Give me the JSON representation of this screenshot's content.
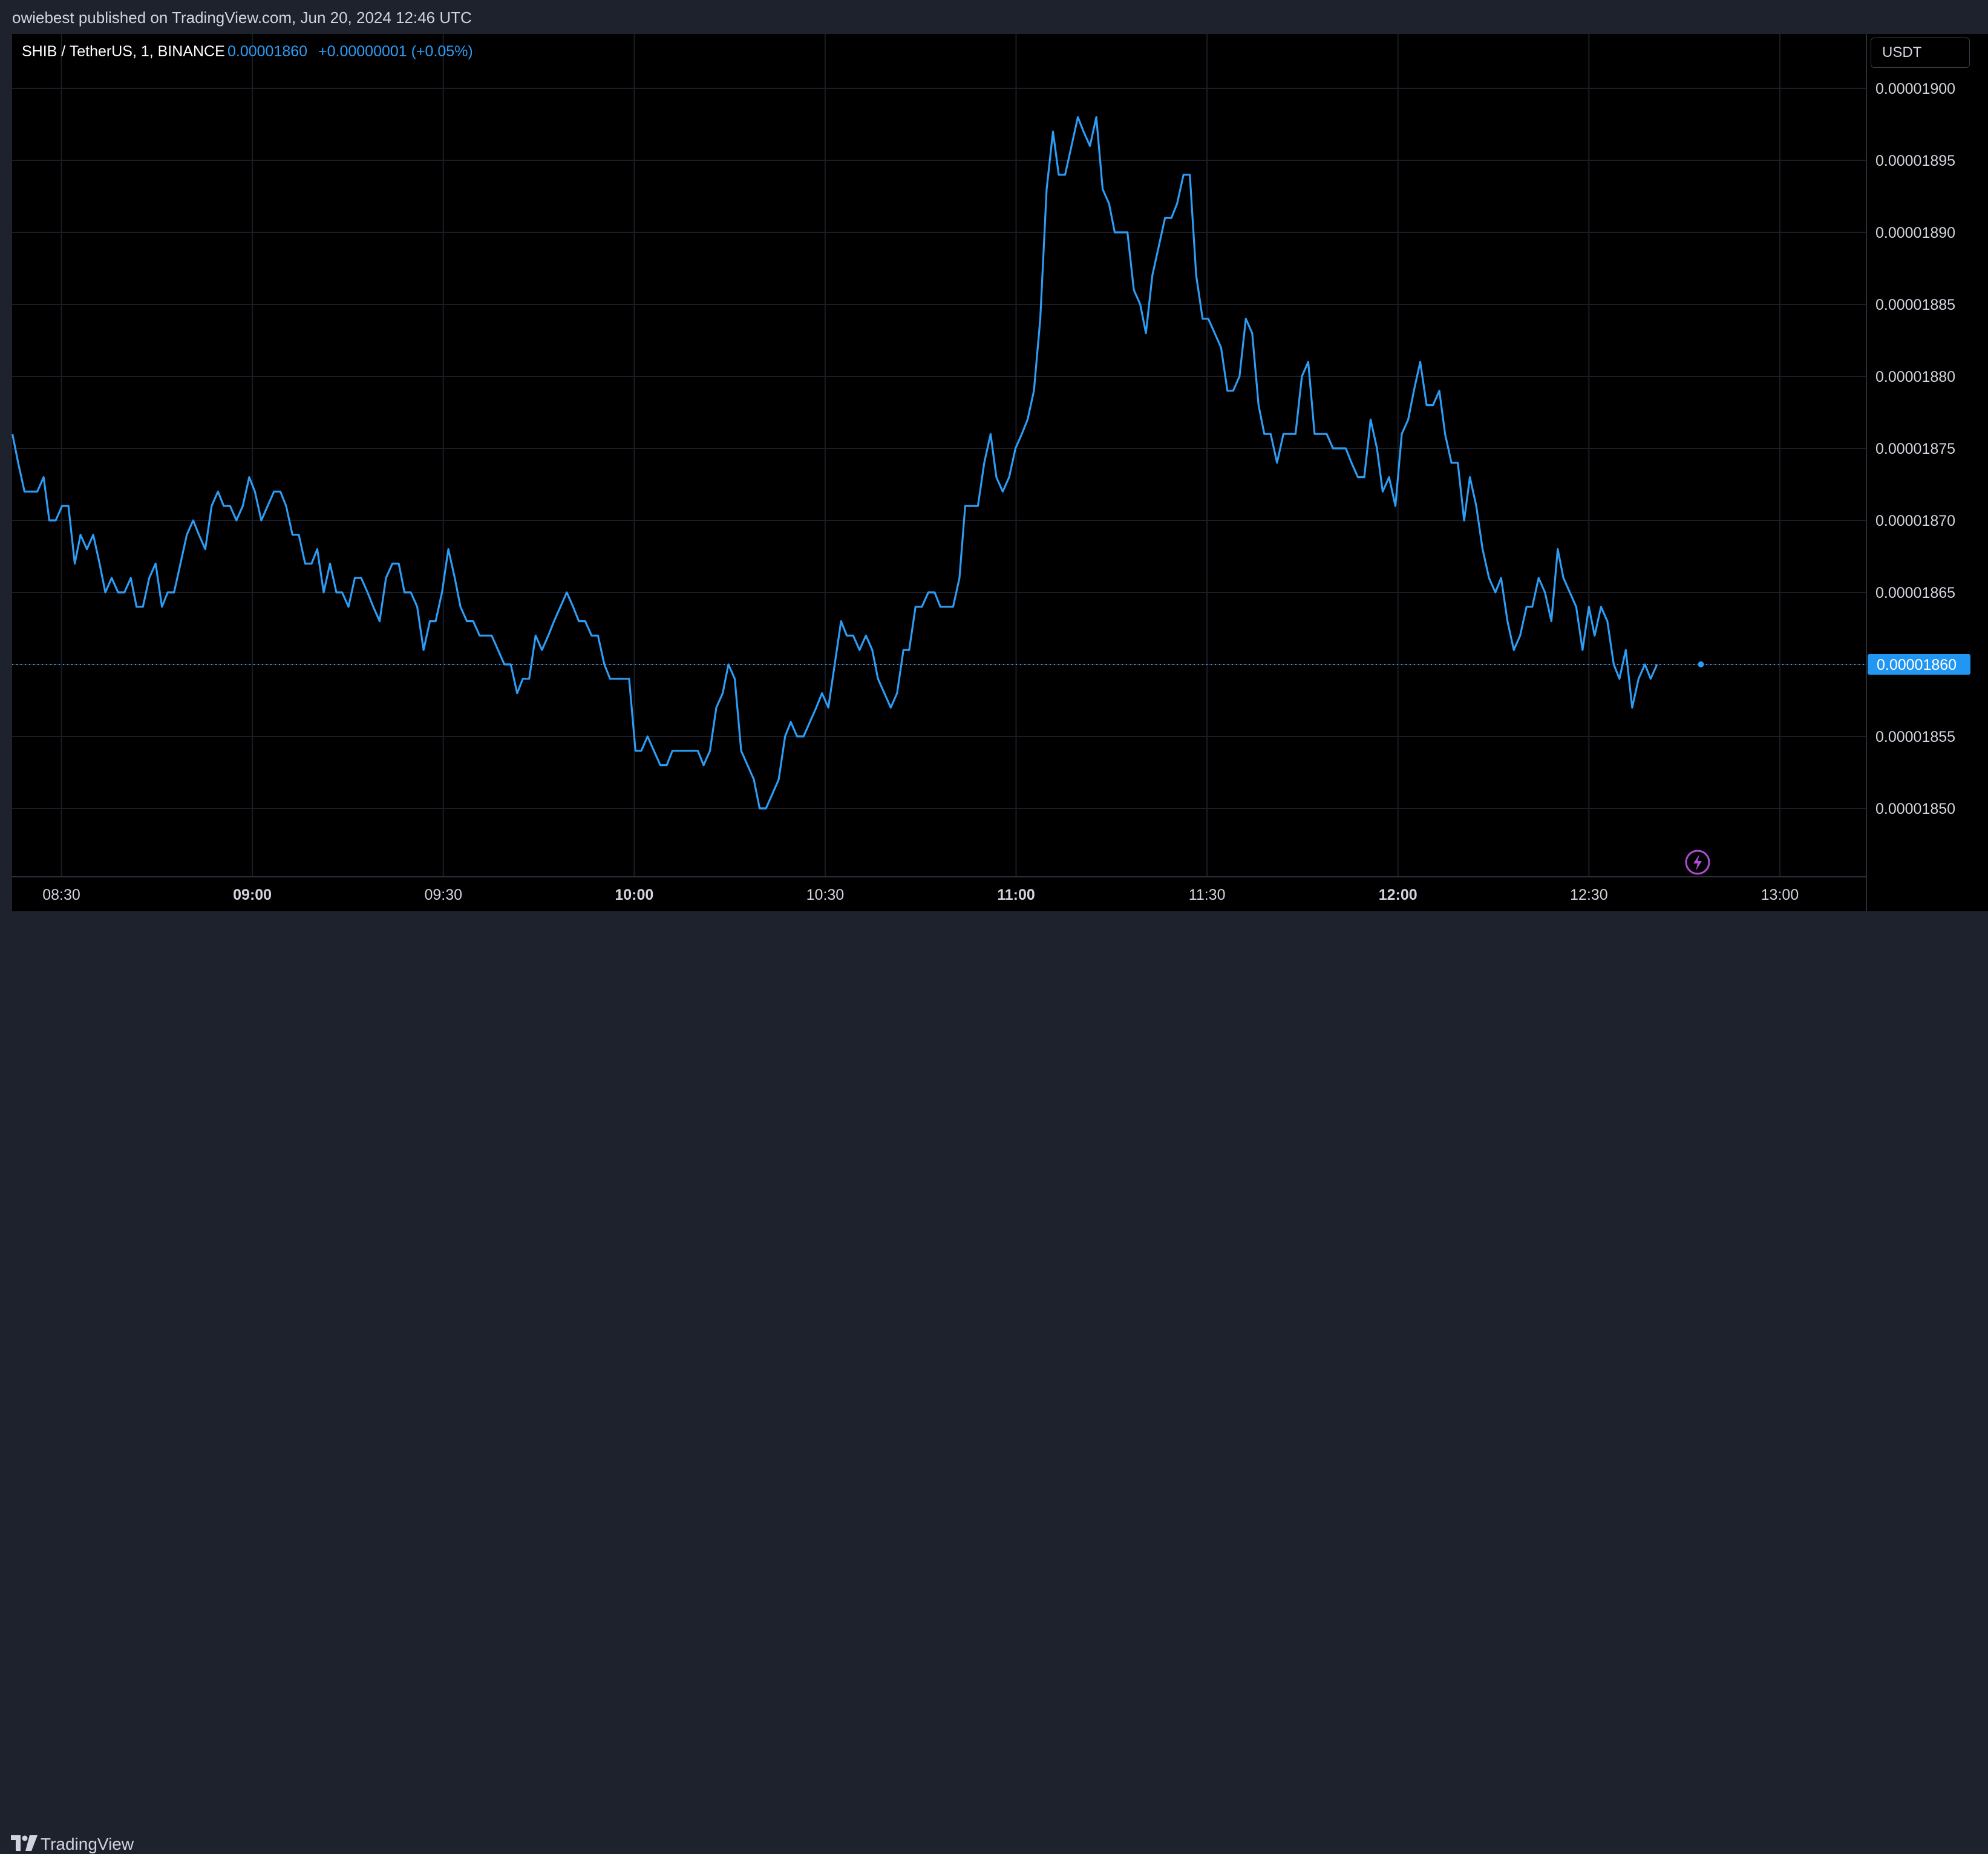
{
  "header": {
    "published_text": "owiebest published on TradingView.com, Jun 20, 2024 12:46 UTC"
  },
  "symbol": {
    "name": "SHIB / TetherUS, 1, BINANCE",
    "price": "0.00001860",
    "change": "+0.00000001 (+0.05%)"
  },
  "unit_label": "USDT",
  "last_price_label": "0.00001860",
  "footer": {
    "brand": "TradingView"
  },
  "icons": {
    "logo": "tradingview-logo-icon",
    "flash": "lightning-icon"
  },
  "colors": {
    "line": "#2d9cf5",
    "price_label_bg": "#2196f3",
    "flash": "#b34dd9",
    "background": "#000000",
    "frame": "#1e222d"
  },
  "chart_data": {
    "type": "line",
    "title": "",
    "xlabel": "",
    "ylabel": "",
    "y_tick_labels": [
      "0.00001900",
      "0.00001895",
      "0.00001890",
      "0.00001885",
      "0.00001880",
      "0.00001875",
      "0.00001870",
      "0.00001865",
      "0.00001860",
      "0.00001855",
      "0.00001850"
    ],
    "y_ticks": [
      1.9e-05,
      1.895e-05,
      1.89e-05,
      1.885e-05,
      1.88e-05,
      1.875e-05,
      1.87e-05,
      1.865e-05,
      1.86e-05,
      1.855e-05,
      1.85e-05
    ],
    "ylim": [
      1.845e-05,
      1.902e-05
    ],
    "x_ticks": [
      {
        "label": "08:30",
        "minute": 510,
        "bold": false
      },
      {
        "label": "09:00",
        "minute": 540,
        "bold": true
      },
      {
        "label": "09:30",
        "minute": 570,
        "bold": false
      },
      {
        "label": "10:00",
        "minute": 600,
        "bold": true
      },
      {
        "label": "10:30",
        "minute": 630,
        "bold": false
      },
      {
        "label": "11:00",
        "minute": 660,
        "bold": true
      },
      {
        "label": "11:30",
        "minute": 690,
        "bold": false
      },
      {
        "label": "12:00",
        "minute": 720,
        "bold": true
      },
      {
        "label": "12:30",
        "minute": 750,
        "bold": false
      },
      {
        "label": "13:00",
        "minute": 780,
        "bold": false
      }
    ],
    "x_range_minutes": [
      502.25,
      793.6
    ],
    "last_price": 1.86e-05,
    "series": [
      {
        "x_minutes": [
          502.3,
          503.2,
          504.2,
          505.2,
          506.2,
          507.2,
          508.1,
          509.1,
          510.1,
          511.1,
          512.1,
          513.0,
          514.0,
          515.0,
          516.0,
          516.9,
          517.9,
          518.9,
          519.9,
          520.9,
          521.8,
          522.8,
          523.8,
          524.8,
          525.8,
          526.7,
          527.7,
          528.7,
          529.7,
          530.7,
          531.6,
          532.6,
          533.6,
          534.6,
          535.5,
          536.5,
          537.5,
          538.5,
          539.5,
          540.4,
          541.4,
          542.4,
          543.4,
          544.4,
          545.3,
          546.3,
          547.3,
          548.3,
          549.3,
          550.2,
          551.2,
          552.2,
          553.2,
          554.1,
          555.1,
          556.1,
          557.1,
          558.1,
          559.0,
          560.0,
          561.0,
          562.0,
          563.0,
          563.9,
          564.9,
          565.9,
          566.9,
          567.9,
          568.8,
          569.8,
          570.8,
          571.8,
          572.7,
          573.7,
          574.7,
          575.7,
          576.7,
          577.6,
          578.6,
          579.6,
          580.6,
          581.6,
          582.5,
          583.5,
          584.5,
          585.5,
          586.5,
          587.4,
          588.4,
          589.4,
          590.4,
          591.3,
          592.3,
          593.3,
          594.3,
          595.3,
          596.2,
          597.2,
          598.2,
          599.2,
          600.2,
          601.1,
          602.1,
          603.1,
          604.1,
          605.1,
          606.0,
          607.0,
          608.0,
          609.0,
          610.0,
          610.9,
          611.9,
          612.9,
          613.9,
          614.8,
          615.8,
          616.8,
          617.8,
          618.8,
          619.7,
          620.7,
          621.7,
          622.7,
          623.7,
          624.6,
          625.6,
          626.6,
          627.6,
          628.6,
          629.5,
          630.5,
          631.5,
          632.5,
          633.4,
          634.4,
          635.4,
          636.4,
          637.4,
          638.3,
          639.3,
          640.3,
          641.3,
          642.3,
          643.2,
          644.2,
          645.2,
          646.2,
          647.2,
          648.1,
          649.1,
          650.1,
          651.1,
          652.0,
          653.0,
          654.0,
          655.0,
          656.0,
          656.9,
          657.9,
          658.9,
          659.9,
          660.9,
          661.8,
          662.8,
          663.8,
          664.8,
          665.8,
          666.7,
          667.7,
          668.7,
          669.7,
          670.6,
          671.6,
          672.6,
          673.6,
          674.6,
          675.5,
          676.5,
          677.5,
          678.5,
          679.5,
          680.4,
          681.4,
          682.4,
          683.4,
          684.4,
          685.3,
          686.3,
          687.3,
          688.3,
          689.3,
          690.2,
          691.2,
          692.2,
          693.2,
          694.1,
          695.1,
          696.1,
          697.1,
          698.1,
          699.0,
          700.0,
          701.0,
          702.0,
          703.0,
          703.9,
          704.9,
          705.9,
          706.9,
          707.9,
          708.8,
          709.8,
          710.8,
          711.8,
          712.7,
          713.7,
          714.7,
          715.7,
          716.7,
          717.6,
          718.6,
          719.6,
          720.6,
          721.6,
          722.5,
          723.5,
          724.5,
          725.5,
          726.5,
          727.4,
          728.4,
          729.4,
          730.4,
          731.3,
          732.3,
          733.3,
          734.3,
          735.3,
          736.2,
          737.2,
          738.2,
          739.2,
          740.2,
          741.1,
          742.1,
          743.1,
          744.1,
          745.1,
          746.0,
          747.0,
          748.0,
          749.0,
          750.0,
          750.9,
          751.9,
          752.9,
          753.9,
          754.8,
          755.8,
          756.8,
          757.8,
          758.8,
          759.7,
          760.7,
          761.7,
          762.7,
          763.7,
          764.6,
          765.6,
          766.6,
          767.6
        ],
        "values": [
          1.876e-05,
          1.874e-05,
          1.872e-05,
          1.872e-05,
          1.872e-05,
          1.873e-05,
          1.87e-05,
          1.87e-05,
          1.871e-05,
          1.871e-05,
          1.867e-05,
          1.869e-05,
          1.868e-05,
          1.869e-05,
          1.867e-05,
          1.865e-05,
          1.866e-05,
          1.865e-05,
          1.865e-05,
          1.866e-05,
          1.864e-05,
          1.864e-05,
          1.866e-05,
          1.867e-05,
          1.864e-05,
          1.865e-05,
          1.865e-05,
          1.867e-05,
          1.869e-05,
          1.87e-05,
          1.869e-05,
          1.868e-05,
          1.871e-05,
          1.872e-05,
          1.871e-05,
          1.871e-05,
          1.87e-05,
          1.871e-05,
          1.873e-05,
          1.872e-05,
          1.87e-05,
          1.871e-05,
          1.872e-05,
          1.872e-05,
          1.871e-05,
          1.869e-05,
          1.869e-05,
          1.867e-05,
          1.867e-05,
          1.868e-05,
          1.865e-05,
          1.867e-05,
          1.865e-05,
          1.865e-05,
          1.864e-05,
          1.866e-05,
          1.866e-05,
          1.865e-05,
          1.864e-05,
          1.863e-05,
          1.866e-05,
          1.867e-05,
          1.867e-05,
          1.865e-05,
          1.865e-05,
          1.864e-05,
          1.861e-05,
          1.863e-05,
          1.863e-05,
          1.865e-05,
          1.868e-05,
          1.866e-05,
          1.864e-05,
          1.863e-05,
          1.863e-05,
          1.862e-05,
          1.862e-05,
          1.862e-05,
          1.861e-05,
          1.86e-05,
          1.86e-05,
          1.858e-05,
          1.859e-05,
          1.859e-05,
          1.862e-05,
          1.861e-05,
          1.862e-05,
          1.863e-05,
          1.864e-05,
          1.865e-05,
          1.864e-05,
          1.863e-05,
          1.863e-05,
          1.862e-05,
          1.862e-05,
          1.86e-05,
          1.859e-05,
          1.859e-05,
          1.859e-05,
          1.859e-05,
          1.854e-05,
          1.854e-05,
          1.855e-05,
          1.854e-05,
          1.853e-05,
          1.853e-05,
          1.854e-05,
          1.854e-05,
          1.854e-05,
          1.854e-05,
          1.854e-05,
          1.853e-05,
          1.854e-05,
          1.857e-05,
          1.858e-05,
          1.86e-05,
          1.859e-05,
          1.854e-05,
          1.853e-05,
          1.852e-05,
          1.85e-05,
          1.85e-05,
          1.851e-05,
          1.852e-05,
          1.855e-05,
          1.856e-05,
          1.855e-05,
          1.855e-05,
          1.856e-05,
          1.857e-05,
          1.858e-05,
          1.857e-05,
          1.86e-05,
          1.863e-05,
          1.862e-05,
          1.862e-05,
          1.861e-05,
          1.862e-05,
          1.861e-05,
          1.859e-05,
          1.858e-05,
          1.857e-05,
          1.858e-05,
          1.861e-05,
          1.861e-05,
          1.864e-05,
          1.864e-05,
          1.865e-05,
          1.865e-05,
          1.864e-05,
          1.864e-05,
          1.864e-05,
          1.866e-05,
          1.871e-05,
          1.871e-05,
          1.871e-05,
          1.874e-05,
          1.876e-05,
          1.873e-05,
          1.872e-05,
          1.873e-05,
          1.875e-05,
          1.876e-05,
          1.877e-05,
          1.879e-05,
          1.884e-05,
          1.893e-05,
          1.897e-05,
          1.894e-05,
          1.894e-05,
          1.896e-05,
          1.898e-05,
          1.897e-05,
          1.896e-05,
          1.898e-05,
          1.893e-05,
          1.892e-05,
          1.89e-05,
          1.89e-05,
          1.89e-05,
          1.886e-05,
          1.885e-05,
          1.883e-05,
          1.887e-05,
          1.889e-05,
          1.891e-05,
          1.891e-05,
          1.892e-05,
          1.894e-05,
          1.894e-05,
          1.887e-05,
          1.884e-05,
          1.884e-05,
          1.883e-05,
          1.882e-05,
          1.879e-05,
          1.879e-05,
          1.88e-05,
          1.884e-05,
          1.883e-05,
          1.878e-05,
          1.876e-05,
          1.876e-05,
          1.874e-05,
          1.876e-05,
          1.876e-05,
          1.876e-05,
          1.88e-05,
          1.881e-05,
          1.876e-05,
          1.876e-05,
          1.876e-05,
          1.875e-05,
          1.875e-05,
          1.875e-05,
          1.874e-05,
          1.873e-05,
          1.873e-05,
          1.877e-05,
          1.875e-05,
          1.872e-05,
          1.873e-05,
          1.871e-05,
          1.876e-05,
          1.877e-05,
          1.879e-05,
          1.881e-05,
          1.878e-05,
          1.878e-05,
          1.879e-05,
          1.876e-05,
          1.874e-05,
          1.874e-05,
          1.87e-05,
          1.873e-05,
          1.871e-05,
          1.868e-05,
          1.866e-05,
          1.865e-05,
          1.866e-05,
          1.863e-05,
          1.861e-05,
          1.862e-05,
          1.864e-05,
          1.864e-05,
          1.866e-05,
          1.865e-05,
          1.863e-05,
          1.868e-05,
          1.866e-05,
          1.865e-05,
          1.864e-05,
          1.861e-05,
          1.864e-05,
          1.862e-05,
          1.864e-05,
          1.863e-05,
          1.86e-05,
          1.859e-05,
          1.861e-05,
          1.857e-05,
          1.859e-05,
          1.86e-05,
          1.859e-05,
          1.86e-05
        ]
      }
    ]
  }
}
